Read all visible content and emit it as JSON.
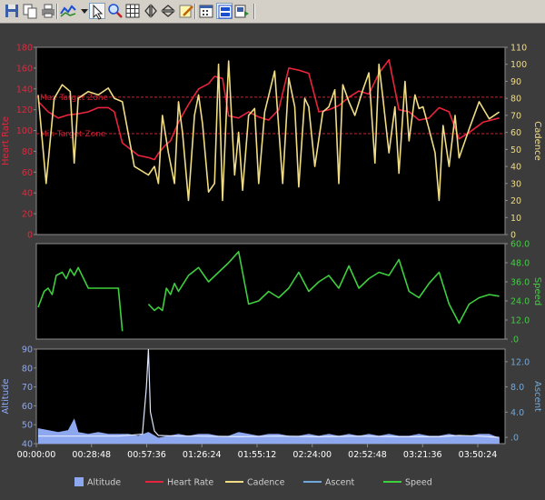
{
  "toolbar": {
    "buttons": [
      {
        "icon": "save-icon"
      },
      {
        "icon": "copy-icon"
      },
      {
        "icon": "print-icon"
      },
      {
        "icon": "line-chart-icon"
      },
      {
        "icon": "dropdown-arrow-icon"
      },
      {
        "icon": "select-pointer-icon",
        "active": true
      },
      {
        "icon": "zoom-icon"
      },
      {
        "icon": "grid-icon"
      },
      {
        "icon": "flip-horizontal-icon"
      },
      {
        "icon": "flip-vertical-icon"
      },
      {
        "icon": "edit-icon"
      },
      {
        "icon": "calendar-icon"
      },
      {
        "icon": "panel-view-icon",
        "active": true
      },
      {
        "icon": "export-icon"
      }
    ]
  },
  "colors": {
    "heart_rate": "#e8243c",
    "cadence": "#f0dc82",
    "speed": "#3ecf3e",
    "altitude": "#8ea8f0",
    "ascent": "#6fa8dc",
    "zone_line": "#cc2233"
  },
  "chart_data": [
    {
      "type": "line",
      "panel": "top",
      "left_axis": {
        "label": "Heart Rate",
        "ticks": [
          "180",
          "160",
          "140",
          "120",
          "100",
          "80",
          "60",
          "40",
          "20",
          "0"
        ],
        "range": [
          0,
          180
        ]
      },
      "right_axis": {
        "label": "Cadence",
        "ticks": [
          "110",
          "100",
          "90",
          "80",
          "70",
          "60",
          "50",
          "40",
          "30",
          "20",
          "10",
          "0"
        ],
        "range": [
          0,
          110
        ]
      },
      "zones": [
        {
          "label": "Max Target Zone",
          "value": 132
        },
        {
          "label": "Min Target Zone",
          "value": 97
        }
      ],
      "series": [
        {
          "name": "Heart Rate",
          "axis": "left",
          "x": [
            0,
            5,
            10,
            15,
            20,
            25,
            30,
            35,
            38,
            42,
            50,
            55,
            58,
            60,
            63,
            66,
            70,
            75,
            80,
            85,
            88,
            92,
            95,
            100,
            105,
            110,
            115,
            120,
            125,
            130,
            135,
            140,
            145,
            150,
            155,
            160,
            165,
            170,
            175,
            180,
            185,
            190,
            195,
            200,
            205,
            210,
            215,
            222,
            230
          ],
          "values": [
            128,
            118,
            112,
            115,
            116,
            118,
            122,
            122,
            118,
            88,
            76,
            74,
            72,
            78,
            85,
            90,
            108,
            125,
            140,
            145,
            152,
            150,
            114,
            112,
            118,
            113,
            110,
            120,
            160,
            158,
            155,
            118,
            120,
            124,
            132,
            138,
            135,
            155,
            168,
            120,
            118,
            110,
            112,
            122,
            118,
            92,
            98,
            108,
            112
          ]
        },
        {
          "name": "Cadence",
          "axis": "right",
          "x": [
            0,
            4,
            8,
            12,
            16,
            18,
            20,
            25,
            30,
            35,
            38,
            42,
            48,
            55,
            58,
            60,
            62,
            65,
            68,
            70,
            72,
            75,
            78,
            80,
            82,
            85,
            88,
            90,
            92,
            95,
            98,
            100,
            102,
            105,
            108,
            110,
            113,
            118,
            122,
            125,
            128,
            130,
            133,
            135,
            138,
            142,
            145,
            148,
            150,
            152,
            155,
            158,
            162,
            165,
            168,
            170,
            172,
            175,
            178,
            180,
            183,
            185,
            188,
            190,
            192,
            195,
            198,
            200,
            202,
            205,
            208,
            210,
            215,
            220,
            225,
            230
          ],
          "values": [
            82,
            30,
            80,
            88,
            84,
            42,
            80,
            84,
            82,
            86,
            80,
            78,
            40,
            35,
            40,
            30,
            70,
            48,
            30,
            78,
            60,
            20,
            70,
            82,
            65,
            25,
            30,
            100,
            20,
            102,
            35,
            60,
            26,
            70,
            74,
            30,
            72,
            96,
            30,
            92,
            75,
            28,
            80,
            75,
            40,
            72,
            75,
            85,
            30,
            88,
            78,
            70,
            85,
            95,
            42,
            100,
            80,
            48,
            75,
            36,
            90,
            55,
            82,
            74,
            75,
            62,
            48,
            20,
            64,
            40,
            70,
            45,
            62,
            78,
            68,
            72
          ]
        }
      ]
    },
    {
      "type": "line",
      "panel": "middle",
      "right_axis": {
        "label": "Speed",
        "ticks": [
          "60.0",
          "48.0",
          "36.0",
          "24.0",
          "12.0",
          ".0"
        ],
        "range": [
          0,
          60
        ]
      },
      "series": [
        {
          "name": "Speed",
          "axis": "right",
          "x": [
            0,
            3,
            5,
            7,
            9,
            12,
            14,
            16,
            18,
            20,
            25,
            30,
            35,
            40,
            42,
            52,
            55,
            58,
            60,
            62,
            64,
            66,
            68,
            70,
            75,
            80,
            85,
            90,
            95,
            100,
            105,
            110,
            115,
            120,
            125,
            130,
            135,
            140,
            145,
            150,
            155,
            160,
            165,
            170,
            175,
            180,
            185,
            190,
            195,
            200,
            205,
            210,
            215,
            220,
            225,
            230
          ],
          "values": [
            20,
            30,
            32,
            28,
            40,
            42,
            38,
            44,
            40,
            45,
            32,
            32,
            32,
            32,
            5,
            null,
            22,
            18,
            20,
            18,
            32,
            28,
            35,
            30,
            40,
            45,
            36,
            42,
            48,
            55,
            22,
            24,
            30,
            26,
            32,
            42,
            30,
            36,
            40,
            32,
            46,
            32,
            38,
            42,
            40,
            50,
            30,
            26,
            35,
            42,
            22,
            10,
            22,
            26,
            28,
            27
          ]
        }
      ]
    },
    {
      "type": "area",
      "panel": "bottom",
      "left_axis": {
        "label": "Altitude",
        "ticks": [
          "90",
          "80",
          "70",
          "60",
          "50",
          "40"
        ],
        "range": [
          40,
          90
        ]
      },
      "right_axis": {
        "label": "Ascent",
        "ticks": [
          "12.0",
          "8.0",
          "4.0",
          ".0"
        ],
        "range": [
          -1,
          14
        ]
      },
      "x_axis": {
        "ticks": [
          "00:00:00",
          "00:28:48",
          "00:57:36",
          "01:26:24",
          "01:55:12",
          "02:24:00",
          "02:52:48",
          "03:21:36",
          "03:50:24"
        ]
      },
      "series": [
        {
          "name": "Altitude",
          "axis": "left",
          "x": [
            0,
            5,
            10,
            15,
            18,
            20,
            25,
            30,
            35,
            40,
            45,
            50,
            55,
            60,
            65,
            70,
            75,
            80,
            85,
            90,
            95,
            100,
            105,
            110,
            115,
            120,
            125,
            130,
            135,
            140,
            145,
            150,
            155,
            160,
            165,
            170,
            175,
            180,
            185,
            190,
            195,
            200,
            205,
            210,
            215,
            220,
            225,
            230
          ],
          "values": [
            48,
            47,
            46,
            47,
            53,
            46,
            45,
            46,
            45,
            45,
            45,
            44,
            46,
            43,
            44,
            45,
            44,
            45,
            45,
            44,
            44,
            46,
            45,
            44,
            45,
            45,
            44,
            44,
            45,
            44,
            45,
            44,
            45,
            44,
            45,
            44,
            45,
            44,
            44,
            45,
            44,
            44,
            45,
            44,
            44,
            45,
            45,
            43
          ]
        },
        {
          "name": "Ascent",
          "axis": "right",
          "x": [
            0,
            20,
            40,
            52,
            54,
            55,
            56,
            58,
            60,
            70,
            80,
            100,
            120,
            140,
            160,
            180,
            200,
            210,
            220,
            230
          ],
          "values": [
            0.2,
            0.2,
            0.2,
            0.5,
            8,
            14,
            4,
            1,
            0.3,
            0.2,
            0.2,
            0.1,
            0.2,
            0.1,
            0.2,
            0.1,
            0.1,
            0.3,
            0.2,
            0
          ]
        }
      ]
    }
  ],
  "legend": [
    {
      "label": "Altitude",
      "kind": "swatch",
      "color": "#8ea8f0"
    },
    {
      "label": "Heart Rate",
      "kind": "line",
      "color": "#e8243c"
    },
    {
      "label": "Cadence",
      "kind": "line",
      "color": "#f0dc82"
    },
    {
      "label": "Ascent",
      "kind": "line",
      "color": "#6fa8dc"
    },
    {
      "label": "Speed",
      "kind": "line",
      "color": "#3ecf3e"
    }
  ]
}
